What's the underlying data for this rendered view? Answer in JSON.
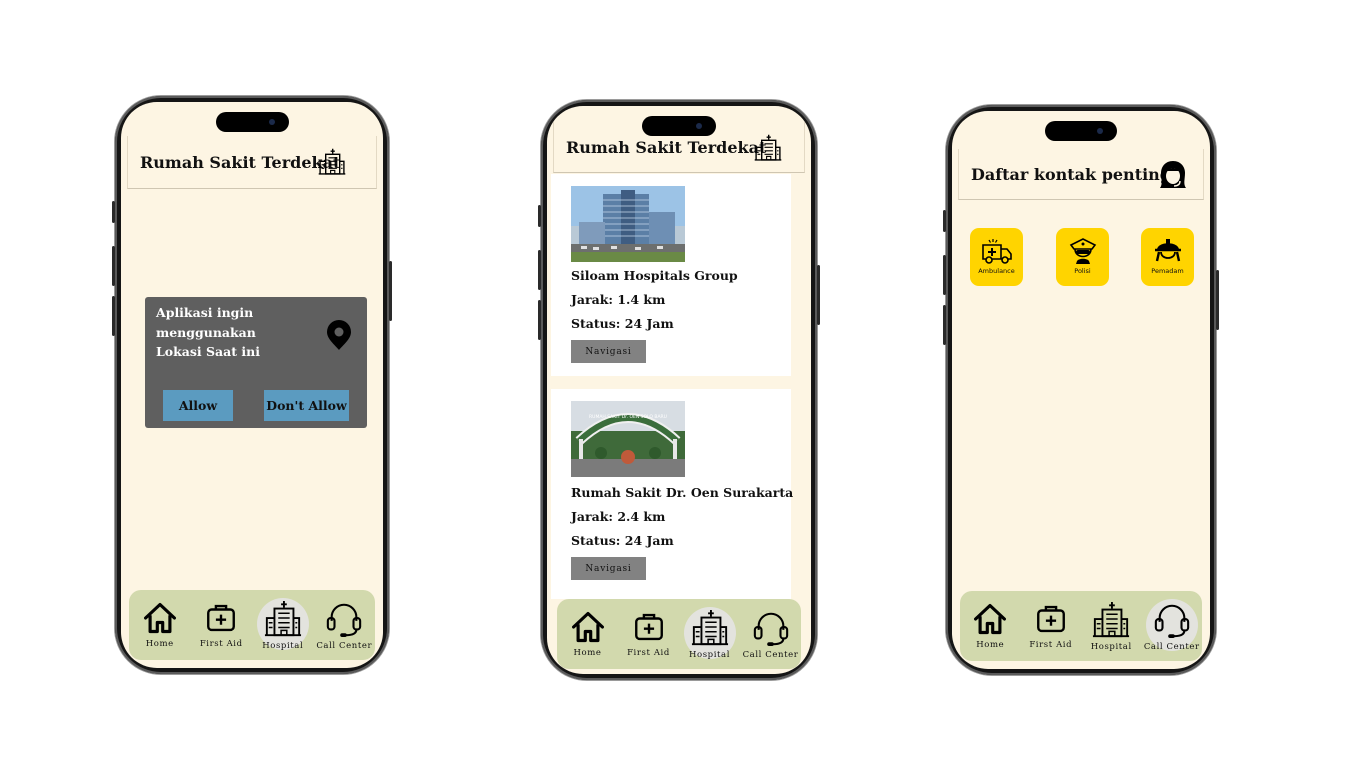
{
  "phone1": {
    "header_title": "Rumah Sakit Terdekat",
    "dialog": {
      "message_line1": "Aplikasi ingin",
      "message_line2": "menggunakan",
      "message_line3": "Lokasi Saat ini",
      "allow_label": "Allow",
      "deny_label": "Don't Allow"
    }
  },
  "phone2": {
    "header_title": "Rumah Sakit Terdekat",
    "hospitals": [
      {
        "name": "Siloam Hospitals Group",
        "distance": "Jarak: 1.4 km",
        "status": "Status: 24 Jam",
        "button": "Navigasi"
      },
      {
        "name": "Rumah Sakit Dr. Oen Surakarta",
        "distance": "Jarak: 2.4 km",
        "status": "Status: 24 Jam",
        "button": "Navigasi",
        "sign_text": "RUMAH SAKIT Dr. OEN SOLO BARU"
      }
    ]
  },
  "phone3": {
    "header_title": "Daftar kontak penting",
    "contacts": [
      {
        "label": "Ambulance",
        "icon": "ambulance-icon"
      },
      {
        "label": "Polisi",
        "icon": "police-icon"
      },
      {
        "label": "Pemadam",
        "icon": "firefighter-icon"
      }
    ]
  },
  "nav": {
    "items": [
      {
        "label": "Home",
        "icon": "home-icon"
      },
      {
        "label": "First Aid",
        "icon": "first-aid-icon"
      },
      {
        "label": "Hospital",
        "icon": "hospital-icon"
      },
      {
        "label": "Call Center",
        "icon": "headset-icon"
      }
    ],
    "active_phone1": "Hospital",
    "active_phone2": "Hospital",
    "active_phone3": "Call Center"
  },
  "colors": {
    "screen_bg": "#fdf5e3",
    "navbar_bg": "#d2d9ad",
    "dialog_bg": "#5f5f5f",
    "dialog_button": "#5b9bc0",
    "nav_button": "#828282",
    "contact_tile": "#ffd400"
  }
}
